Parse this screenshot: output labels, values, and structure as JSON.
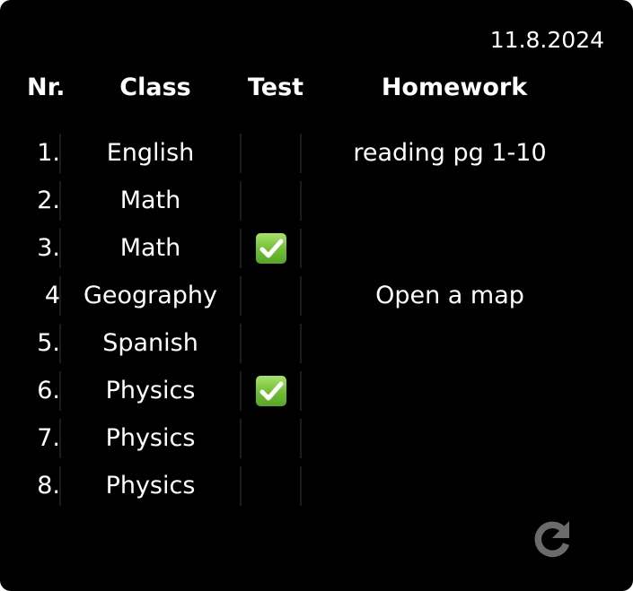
{
  "header": {
    "date": "11.8.2024",
    "columns": {
      "nr": "Nr.",
      "class": "Class",
      "test": "Test",
      "homework": "Homework"
    }
  },
  "rows": [
    {
      "nr": "1.",
      "class": "English",
      "test": false,
      "homework": "reading pg 1-10"
    },
    {
      "nr": "2.",
      "class": "Math",
      "test": false,
      "homework": ""
    },
    {
      "nr": "3.",
      "class": "Math",
      "test": true,
      "homework": ""
    },
    {
      "nr": "4",
      "class": "Geography",
      "test": false,
      "homework": "Open a map"
    },
    {
      "nr": "5.",
      "class": "Spanish",
      "test": false,
      "homework": ""
    },
    {
      "nr": "6.",
      "class": "Physics",
      "test": true,
      "homework": ""
    },
    {
      "nr": "7.",
      "class": "Physics",
      "test": false,
      "homework": ""
    },
    {
      "nr": "8.",
      "class": "Physics",
      "test": false,
      "homework": ""
    }
  ],
  "icons": {
    "test_check": "check-mark-icon",
    "refresh": "refresh-icon"
  },
  "colors": {
    "background": "#000000",
    "text": "#ffffff",
    "check_green": "#6fbe33",
    "refresh_gray": "#6b6b6b"
  }
}
